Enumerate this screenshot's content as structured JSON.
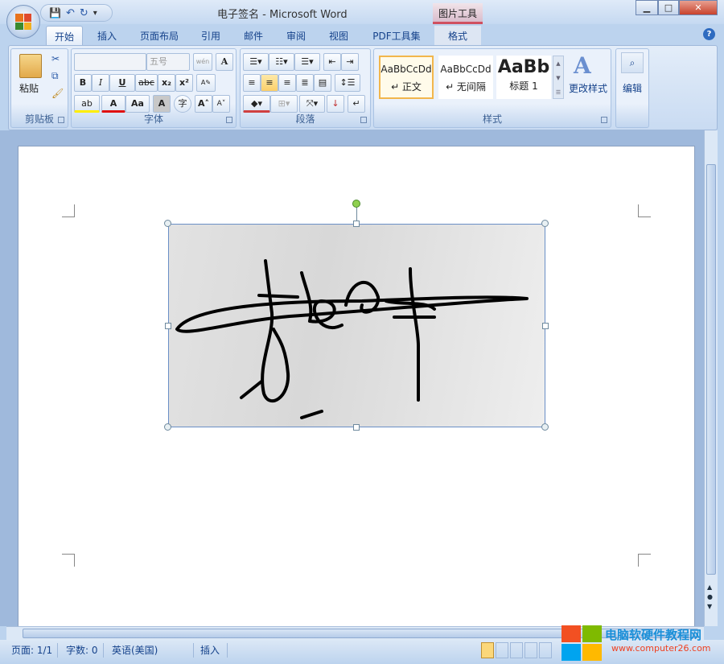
{
  "window": {
    "title": "电子签名 - Microsoft Word",
    "context_tab_group": "图片工具"
  },
  "quick_access": {
    "save": "💾",
    "undo": "↶",
    "redo": "↻",
    "customize": "▾"
  },
  "tabs": [
    {
      "label": "开始",
      "active": true
    },
    {
      "label": "插入"
    },
    {
      "label": "页面布局"
    },
    {
      "label": "引用"
    },
    {
      "label": "邮件"
    },
    {
      "label": "审阅"
    },
    {
      "label": "视图"
    },
    {
      "label": "PDF工具集"
    },
    {
      "label": "格式"
    }
  ],
  "ribbon": {
    "clipboard": {
      "label": "剪贴板",
      "paste": "粘贴"
    },
    "font": {
      "label": "字体",
      "font_name": "",
      "font_size": "五号",
      "bold": "B",
      "italic": "I",
      "underline": "U",
      "strike": "abc",
      "sub": "x₂",
      "sup": "x²",
      "grow": "A˄",
      "shrink": "A˅",
      "case": "Aa",
      "phonetic": "wén",
      "char_border": "A",
      "highlight": "ab",
      "font_color": "A",
      "shade": "A",
      "enclose": "字"
    },
    "paragraph": {
      "label": "段落"
    },
    "styles": {
      "label": "样式",
      "items": [
        {
          "preview": "AaBbCcDd",
          "name": "↵ 正文"
        },
        {
          "preview": "AaBbCcDd",
          "name": "↵ 无间隔"
        },
        {
          "preview": "AaBb",
          "name": "标题 1"
        }
      ],
      "change_styles": "更改样式"
    },
    "editing": {
      "label": "编辑"
    }
  },
  "status": {
    "page": "页面: 1/1",
    "words": "字数: 0",
    "language": "英语(美国)",
    "mode": "插入"
  },
  "watermark": {
    "name": "电脑软硬件教程网",
    "url": "www.computer26.com"
  }
}
